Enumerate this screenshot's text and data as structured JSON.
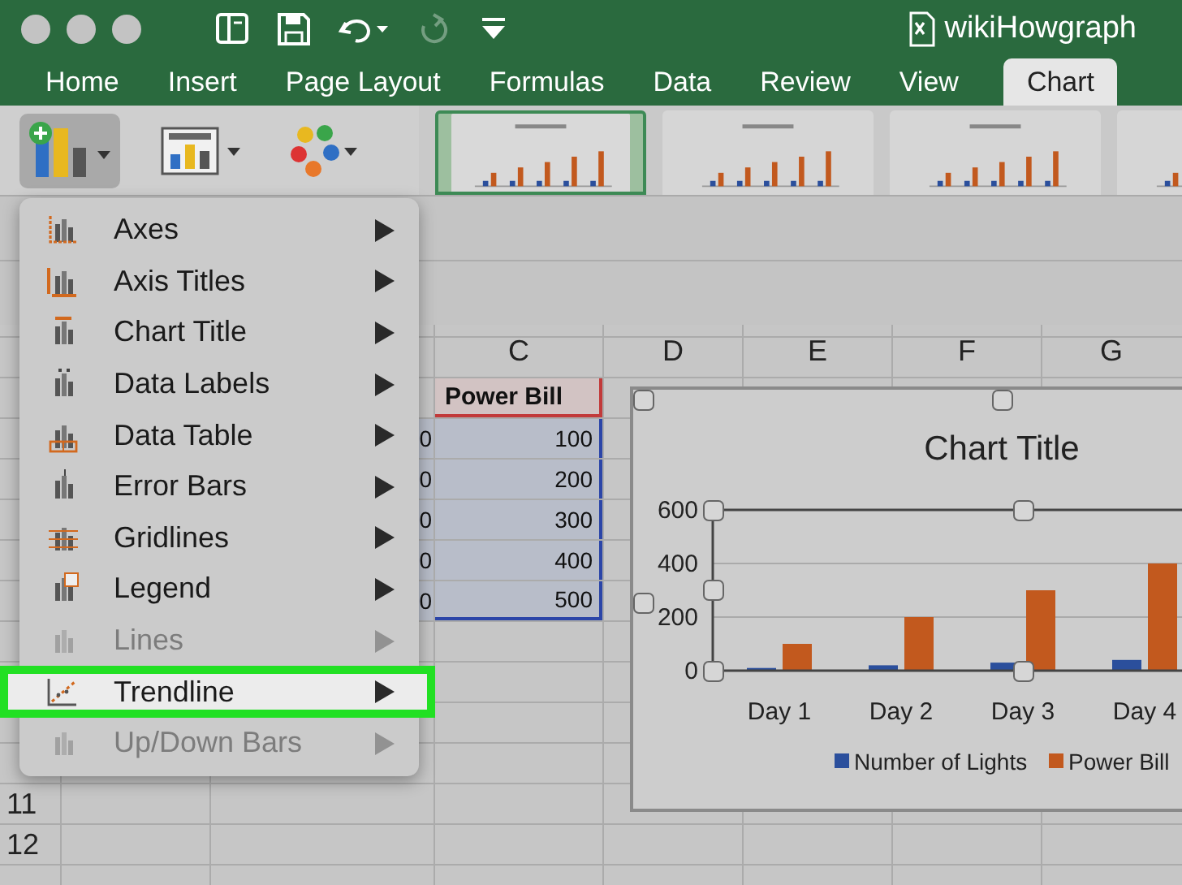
{
  "window": {
    "title": "wikiHowgraph"
  },
  "quick_access": [
    {
      "kind": "sidebar",
      "disabled": false
    },
    {
      "kind": "save",
      "disabled": false
    },
    {
      "kind": "undo",
      "disabled": false
    },
    {
      "kind": "redo",
      "disabled": true
    },
    {
      "kind": "customize",
      "disabled": false
    }
  ],
  "tabs": [
    {
      "label": "Home",
      "selected": false
    },
    {
      "label": "Insert",
      "selected": false
    },
    {
      "label": "Page Layout",
      "selected": false
    },
    {
      "label": "Formulas",
      "selected": false
    },
    {
      "label": "Data",
      "selected": false
    },
    {
      "label": "Review",
      "selected": false
    },
    {
      "label": "View",
      "selected": false
    },
    {
      "label": "Chart",
      "selected": true
    }
  ],
  "ribbon": {
    "buttons": [
      {
        "kind": "add_chart_element",
        "pressed": true
      },
      {
        "kind": "quick_layout",
        "pressed": false
      },
      {
        "kind": "change_colors",
        "pressed": false
      }
    ],
    "styles": [
      {
        "selected": true
      },
      {
        "selected": false
      },
      {
        "selected": false
      },
      {
        "selected": false
      }
    ]
  },
  "sheet": {
    "columns": [
      "C",
      "D",
      "E",
      "F",
      "G"
    ],
    "rows": [
      {
        "kind": "header",
        "column_c": "Power Bill",
        "selected": true
      },
      {
        "kind": "data",
        "column_b": "0",
        "column_c": "100",
        "selected": true
      },
      {
        "kind": "data",
        "column_b": "0",
        "column_c": "200",
        "selected": true
      },
      {
        "kind": "data",
        "column_b": "0",
        "column_c": "300",
        "selected": true
      },
      {
        "kind": "data",
        "column_b": "0",
        "column_c": "400",
        "selected": true
      },
      {
        "kind": "data",
        "column_b": "0",
        "column_c": "500",
        "selected": true
      }
    ],
    "row_headers": [
      "11",
      "12"
    ]
  },
  "chart": {
    "chart_data": {
      "type": "bar",
      "title": "Chart Title",
      "categories": [
        "Day 1",
        "Day 2",
        "Day 3",
        "Day 4"
      ],
      "series": [
        {
          "name": "Number of Lights",
          "color": "#2b4f9c",
          "values": [
            10,
            20,
            30,
            40
          ]
        },
        {
          "name": "Power Bill",
          "color": "#c2591e",
          "values": [
            100,
            200,
            300,
            400
          ]
        }
      ],
      "ylim": [
        0,
        600
      ],
      "yticks": [
        0,
        200,
        400,
        600
      ],
      "legend": "bottom"
    }
  },
  "menu": {
    "items": [
      {
        "kind": "axes",
        "label": "Axes",
        "disabled": false,
        "selected": false
      },
      {
        "kind": "axis_titles",
        "label": "Axis Titles",
        "disabled": false,
        "selected": false
      },
      {
        "kind": "chart_title",
        "label": "Chart Title",
        "disabled": false,
        "selected": false
      },
      {
        "kind": "data_labels",
        "label": "Data Labels",
        "disabled": false,
        "selected": false
      },
      {
        "kind": "data_table",
        "label": "Data Table",
        "disabled": false,
        "selected": false
      },
      {
        "kind": "error_bars",
        "label": "Error Bars",
        "disabled": false,
        "selected": false
      },
      {
        "kind": "gridlines",
        "label": "Gridlines",
        "disabled": false,
        "selected": false
      },
      {
        "kind": "legend",
        "label": "Legend",
        "disabled": false,
        "selected": false
      },
      {
        "kind": "lines",
        "label": "Lines",
        "disabled": true,
        "selected": false
      },
      {
        "kind": "trendline",
        "label": "Trendline",
        "disabled": false,
        "selected": true
      },
      {
        "kind": "up_down_bars",
        "label": "Up/Down Bars",
        "disabled": true,
        "selected": false
      }
    ]
  }
}
